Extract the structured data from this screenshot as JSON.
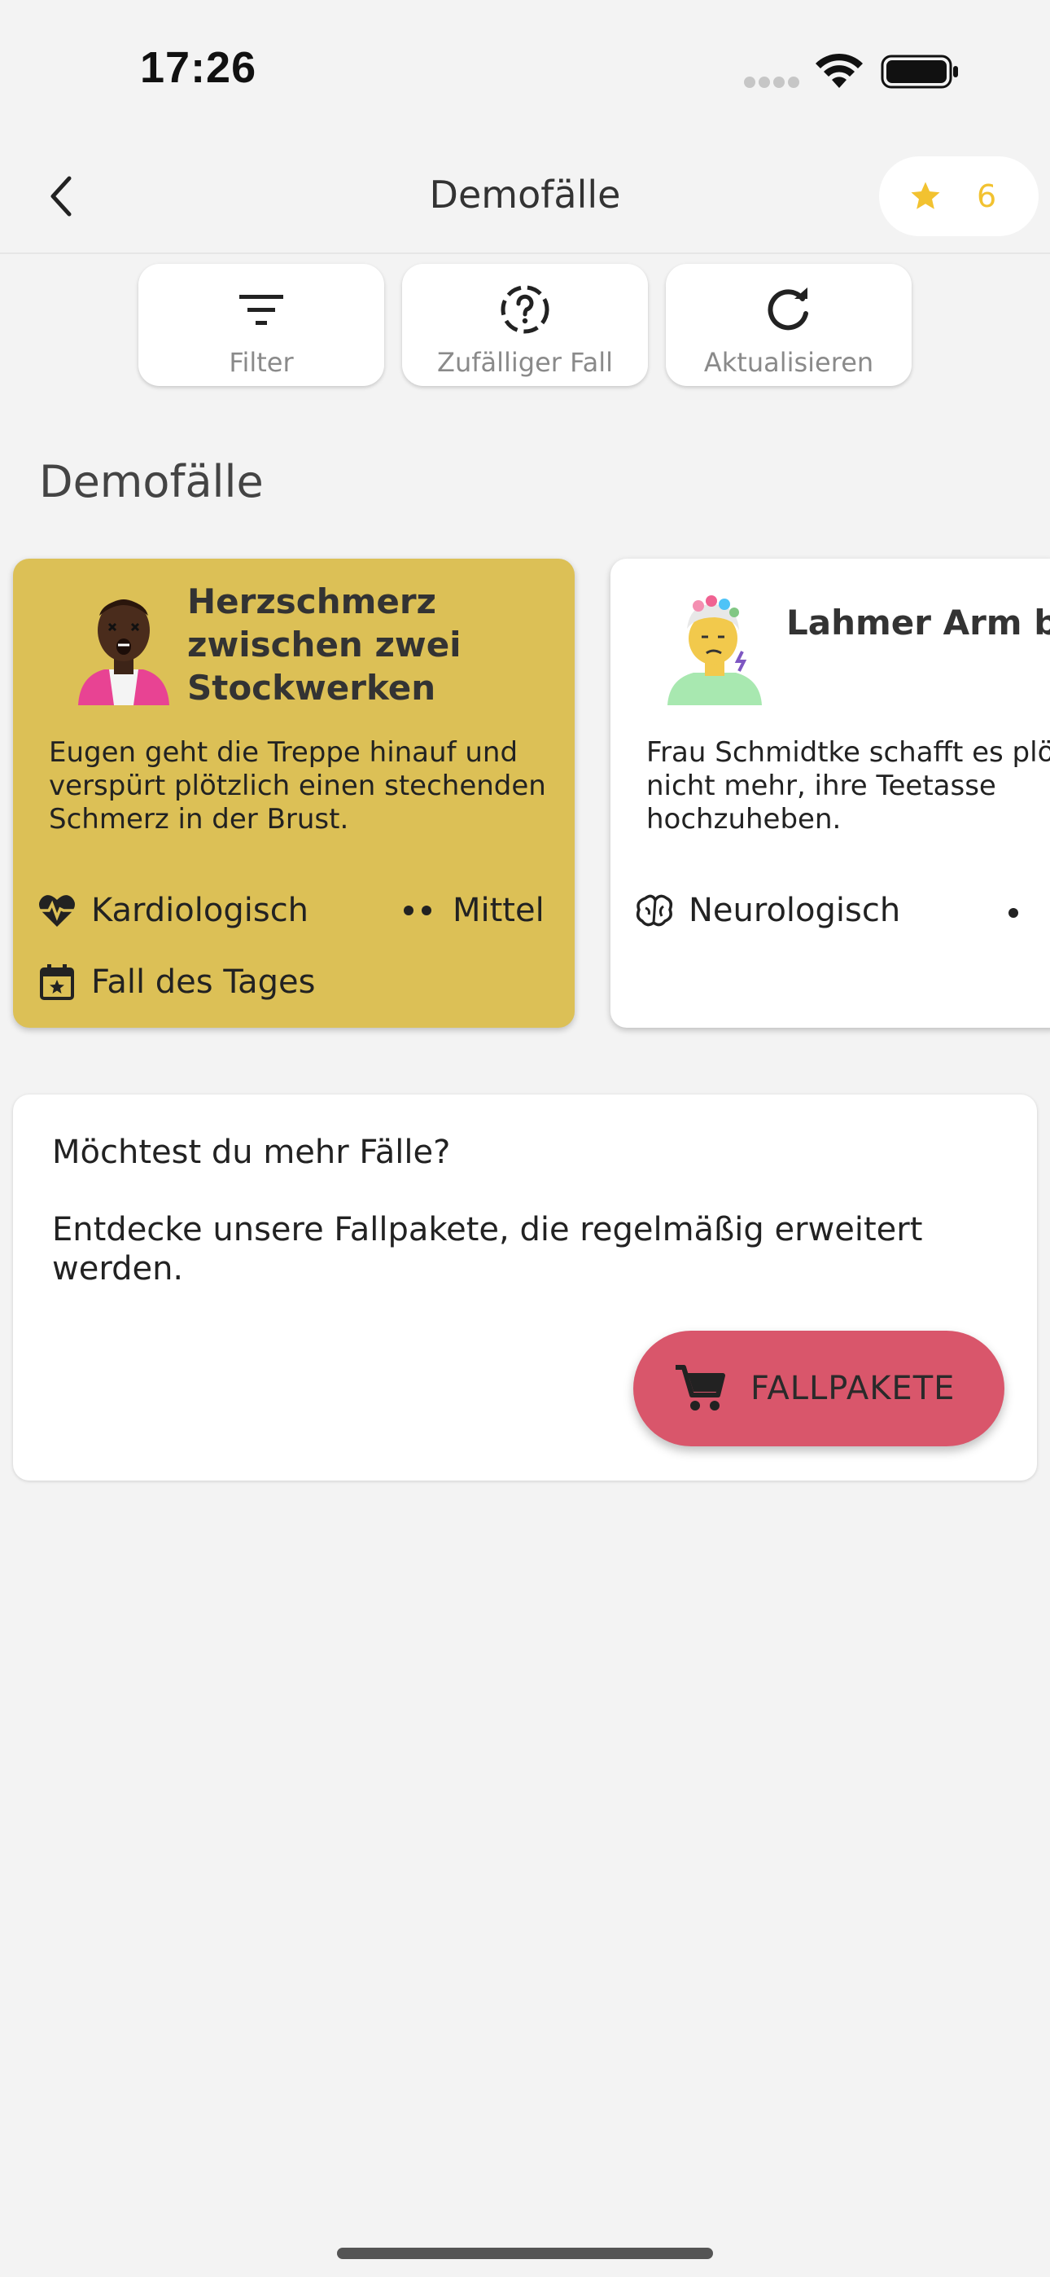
{
  "status_bar": {
    "time": "17:26"
  },
  "header": {
    "title": "Demofälle",
    "stars_count": "6"
  },
  "toolbar": {
    "filter_label": "Filter",
    "random_label": "Zufälliger Fall",
    "refresh_label": "Aktualisieren"
  },
  "section": {
    "title": "Demofälle"
  },
  "cases": [
    {
      "title": "Herzschmerz zwischen zwei Stockwerken",
      "description": "Eugen geht die Treppe hinauf und verspürt plötzlich einen stechenden Schmerz in der Brust.",
      "category": "Kardiologisch",
      "difficulty": "Mittel",
      "tag": "Fall des Tages",
      "card_color": "#dcc056"
    },
    {
      "title": "Lahmer Arm beim Nachmittagstee",
      "description": "Frau Schmidtke schafft es plötzlich nicht mehr, ihre Teetasse hochzuheben.",
      "category": "Neurologisch",
      "card_color": "#ffffff"
    }
  ],
  "promo": {
    "question": "Möchtest du mehr Fälle?",
    "text": "Entdecke unsere Fallpakete, die regelmäßig erweitert werden.",
    "button_label": "FALLPAKETE",
    "button_color": "#d9566b"
  },
  "colors": {
    "star": "#f2c230",
    "background": "#f3f3f3"
  }
}
